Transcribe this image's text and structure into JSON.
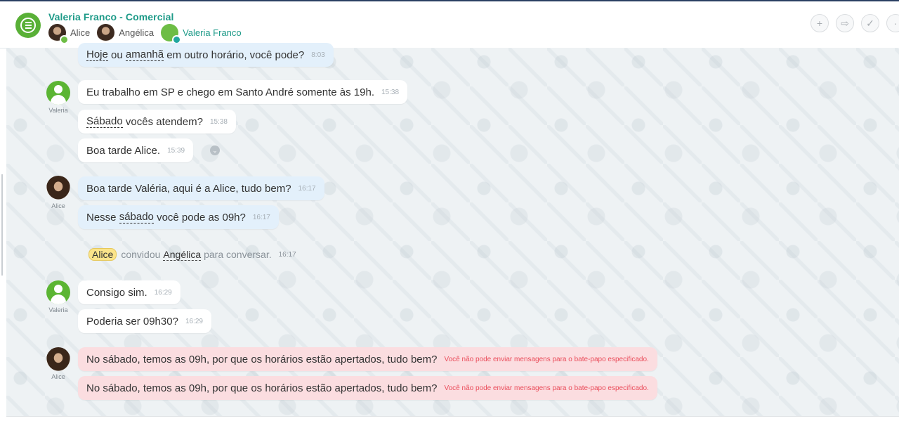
{
  "header": {
    "title": "Valeria Franco - Comercial",
    "members": [
      {
        "name": "Alice"
      },
      {
        "name": "Angélica"
      },
      {
        "name": "Valeria Franco"
      }
    ],
    "buttons": [
      {
        "icon": "plus-icon",
        "glyph": "+"
      },
      {
        "icon": "forward-icon",
        "glyph": "⇨"
      },
      {
        "icon": "check-circle-icon",
        "glyph": "✓"
      },
      {
        "icon": "more-icon",
        "glyph": "·"
      }
    ]
  },
  "messages": {
    "m0": {
      "pre": "",
      "w1": "Hoje",
      "mid": " ou ",
      "w2": "amanhã",
      "post": " em outro horário, você pode?",
      "time": "8:03"
    },
    "m1": {
      "text": "Eu trabalho em SP e chego em Santo André somente às 19h.",
      "time": "15:38"
    },
    "m2": {
      "w": "Sábado",
      "post": " vocês atendem?",
      "time": "15:38"
    },
    "m3": {
      "text": "Boa tarde Alice.",
      "time": "15:39"
    },
    "m4": {
      "text": "Boa tarde Valéria, aqui é a Alice, tudo bem?",
      "time": "16:17"
    },
    "m5": {
      "pre": "Nesse ",
      "w": "sábado",
      "post": " você pode as 09h?",
      "time": "16:17"
    },
    "m6": {
      "text": "Consigo sim.",
      "time": "16:29"
    },
    "m7": {
      "text": "Poderia ser 09h30?",
      "time": "16:29"
    },
    "m8": {
      "text": "No sábado, temos as 09h, por que os horários estão apertados, tudo bem?",
      "error": "Você não pode enviar mensagens para o bate-papo especificado."
    },
    "m9": {
      "text": "No sábado, temos as 09h, por que os horários estão apertados, tudo bem?",
      "error": "Você não pode enviar mensagens para o bate-papo especificado."
    }
  },
  "avatar_labels": {
    "valeria": "Valeria",
    "alice": "Alice"
  },
  "system_message": {
    "inviter": "Alice",
    "action": "convidou",
    "invitee": "Angélica",
    "suffix": "para conversar.",
    "time": "16:17"
  },
  "colors": {
    "accent_green": "#5bb533",
    "title_teal": "#1d9a88",
    "incoming_bubble": "#e3f0fb",
    "error_bubble": "#fbdde0",
    "error_text": "#ea4d5b"
  }
}
